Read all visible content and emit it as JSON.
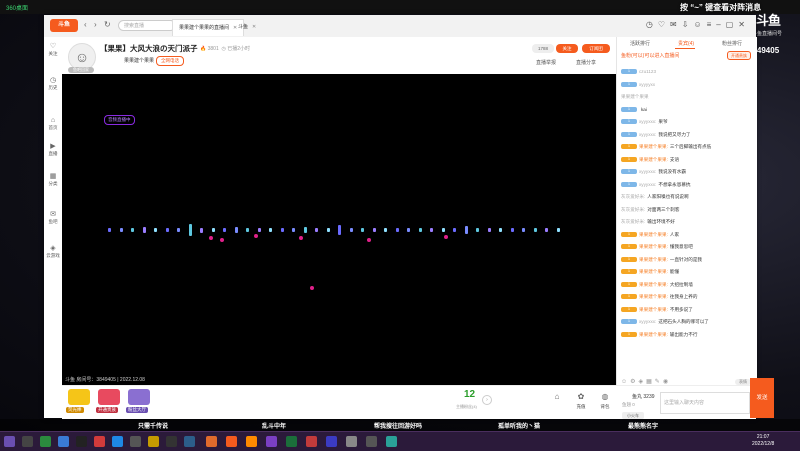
{
  "desktop": {
    "app_name": "360桌面",
    "overlay_text": "按 “~” 键查看对阵消息",
    "watermark": "斗鱼",
    "watermark_sub": "斗鱼直播间号",
    "watermark_room": "3849405"
  },
  "window": {
    "logo": "斗鱼",
    "search_placeholder": "搜索直播",
    "tabs": [
      {
        "label": "果果建个果果的直播间"
      },
      {
        "label": "斗鱼"
      }
    ],
    "icons": [
      "history-icon",
      "heart-icon",
      "message-icon",
      "download-icon",
      "avatar-icon",
      "menu-icon",
      "minimize-icon",
      "maximize-icon",
      "close-icon"
    ]
  },
  "sidebar": {
    "items": [
      {
        "label": "关注",
        "icon": "♡"
      },
      {
        "label": "历史",
        "icon": "◷"
      },
      {
        "label": "首页",
        "icon": "⌂"
      },
      {
        "label": "直播",
        "icon": "▶"
      },
      {
        "label": "分类",
        "icon": "▦"
      },
      {
        "label": "鱼吧",
        "icon": "✉"
      },
      {
        "label": "云游戏",
        "icon": "◈"
      }
    ]
  },
  "room": {
    "title": "【果果】大风大浪の天门派子",
    "hot": "3801",
    "followers_label": "已播2小时",
    "host": "果果建个果果",
    "category": "全网电话",
    "follow_count": "1788",
    "follow_label": "关注",
    "subscribe_label": "订阅团",
    "report_label": "直播举报",
    "share_label": "直播分享",
    "live_badge": "鱼吧回家",
    "video_tag": "音频直播中",
    "video_info": "斗鱼 房间号：3849405 | 2022.12.08"
  },
  "chat": {
    "tabs": [
      "活跃排行",
      "贵宾(4)",
      "粉丝排行"
    ],
    "notice": "鱼粉(可以)可以进入直播间",
    "notice_btn": "开通贵族",
    "messages": [
      {
        "lv": "1",
        "badge": "",
        "user": "czu1123",
        "text": "",
        "orange": false
      },
      {
        "lv": "1",
        "badge": "",
        "user": "xyyyyxx",
        "text": "",
        "orange": false
      },
      {
        "lv": "",
        "badge": "",
        "user": "果果建个果果",
        "text": "",
        "orange": false
      },
      {
        "lv": "1",
        "badge": "",
        "user": "",
        "text": "kai",
        "orange": false
      },
      {
        "lv": "1",
        "badge": "",
        "user": "xyyyxxx:",
        "text": "果爷",
        "orange": false
      },
      {
        "lv": "1",
        "badge": "",
        "user": "xyyyxxx:",
        "text": "我说把又尽力了",
        "orange": false
      },
      {
        "lv": "1",
        "badge": "",
        "user": "果果建个果果:",
        "text": "三个后脚输出有点低",
        "orange": true
      },
      {
        "lv": "1",
        "badge": "",
        "user": "果果建个果果:",
        "text": "支语",
        "orange": true
      },
      {
        "lv": "1",
        "badge": "",
        "user": "xyyyxxx:",
        "text": "我说没有水霸",
        "orange": false
      },
      {
        "lv": "1",
        "badge": "",
        "user": "xyyyxxx:",
        "text": "不想拿永恩慕抗",
        "orange": false
      },
      {
        "lv": "",
        "badge": "",
        "user": "灰灰爱好米:",
        "text": "人家阳嗓也有说说啊",
        "orange": false
      },
      {
        "lv": "",
        "badge": "",
        "user": "灰灰爱好米:",
        "text": "对面两三个刺客",
        "orange": false
      },
      {
        "lv": "",
        "badge": "",
        "user": "灰灰爱好米:",
        "text": "输出环境不好",
        "orange": false
      },
      {
        "lv": "1",
        "badge": "",
        "user": "果果建个果果:",
        "text": "人家",
        "orange": true
      },
      {
        "lv": "1",
        "badge": "",
        "user": "果果建个果果:",
        "text": "懂我意思吧",
        "orange": true
      },
      {
        "lv": "1",
        "badge": "",
        "user": "果果建个果果:",
        "text": "一直针对的是我",
        "orange": true
      },
      {
        "lv": "1",
        "badge": "",
        "user": "果果建个果果:",
        "text": "能懂",
        "orange": true
      },
      {
        "lv": "1",
        "badge": "",
        "user": "果果建个果果:",
        "text": "大招拉制墙",
        "orange": true
      },
      {
        "lv": "1",
        "badge": "",
        "user": "果果建个果果:",
        "text": "往我身上养的",
        "orange": true
      },
      {
        "lv": "1",
        "badge": "",
        "user": "果果建个果果:",
        "text": "不用多说了",
        "orange": true
      },
      {
        "lv": "1",
        "badge": "",
        "user": "xyyyxxx:",
        "text": "这把石头人胸的哪可以了",
        "orange": false
      },
      {
        "lv": "1",
        "badge": "",
        "user": "果果建个果果:",
        "text": "输出能力不行",
        "orange": true
      }
    ],
    "tools_btn": "表情"
  },
  "bottom": {
    "gifts": [
      {
        "label": "荧光棒"
      },
      {
        "label": "开通贵族"
      },
      {
        "label": "粉丝大厅"
      }
    ],
    "gauge": "12",
    "gauge_label": "主播粉丝(4)",
    "actions": [
      {
        "icon": "✿",
        "label": "充值"
      },
      {
        "icon": "◍",
        "label": "背包"
      }
    ],
    "fish_ball": "鱼丸 3239",
    "fish_sub": "鱼翅 0",
    "input_btn": "小火车",
    "input_placeholder": "这里输入聊天内容",
    "send": "发送"
  },
  "ticker": [
    "只需千传说",
    "乱斗中年",
    "帮我搜往回游好吗",
    "孤单听我的丶猫",
    "最熊熊名字"
  ],
  "taskbar": {
    "time": "21:07",
    "date": "2022/12/8"
  }
}
